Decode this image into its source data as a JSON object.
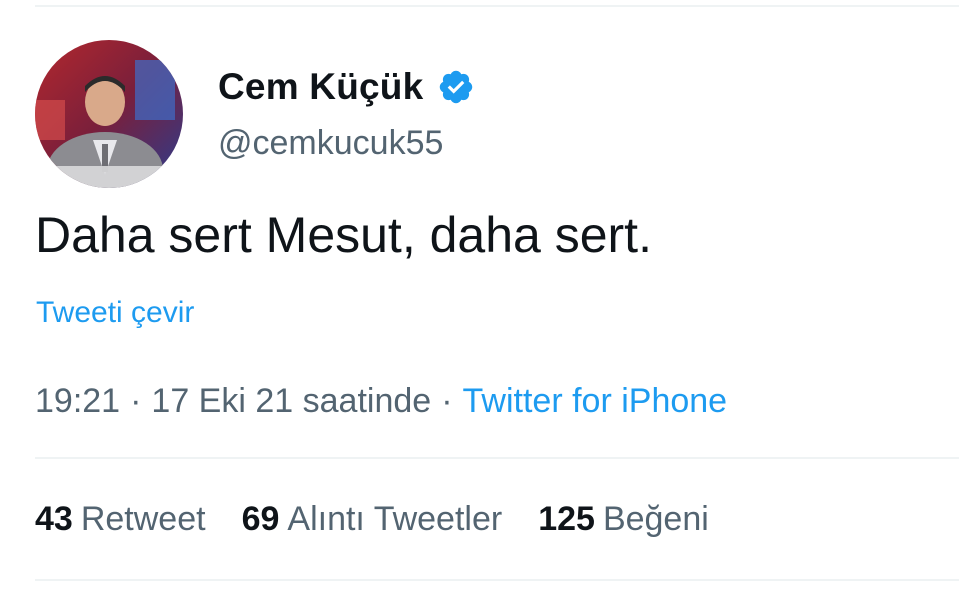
{
  "user": {
    "display_name": "Cem Küçük",
    "handle": "@cemkucuk55",
    "verified": true,
    "avatar_icon": "profile-photo"
  },
  "tweet": {
    "text": "Daha sert Mesut, daha sert.",
    "translate_label": "Tweeti çevir",
    "time": "19:21",
    "date": "17 Eki 21 saatinde",
    "separator": "·",
    "source": "Twitter for iPhone"
  },
  "stats": {
    "retweets": {
      "count": "43",
      "label": "Retweet"
    },
    "quotes": {
      "count": "69",
      "label": "Alıntı Tweetler"
    },
    "likes": {
      "count": "125",
      "label": "Beğeni"
    }
  },
  "colors": {
    "link": "#1d9bf0",
    "secondary_text": "#536471",
    "primary_text": "#0f1419",
    "divider": "#eff3f4",
    "verified_badge": "#1d9bf0"
  }
}
